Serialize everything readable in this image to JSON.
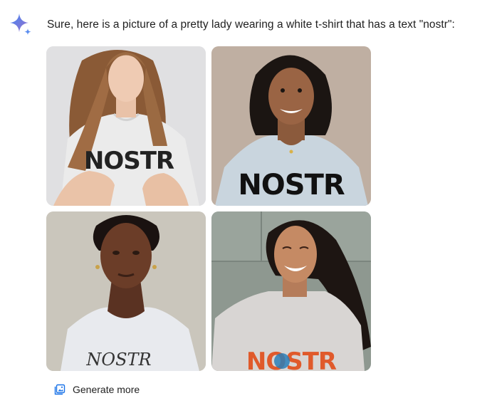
{
  "response": {
    "message": "Sure, here is a picture of a pretty lady wearing a white t-shirt that has a text \"nostr\":"
  },
  "images": [
    {
      "shirt_text": "NOSTR"
    },
    {
      "shirt_text": "NOSTR"
    },
    {
      "shirt_text": "NOSTR"
    },
    {
      "shirt_text": "NOSTR"
    }
  ],
  "actions": {
    "generate_more_label": "Generate more"
  },
  "icons": {
    "assistant": "gemini-sparkle-icon",
    "generate_more": "image-stack-icon"
  },
  "colors": {
    "sparkle_gradient_start": "#4285f4",
    "sparkle_gradient_end": "#9b72cb",
    "text": "#1f1f1f",
    "icon_blue": "#1a73e8"
  }
}
